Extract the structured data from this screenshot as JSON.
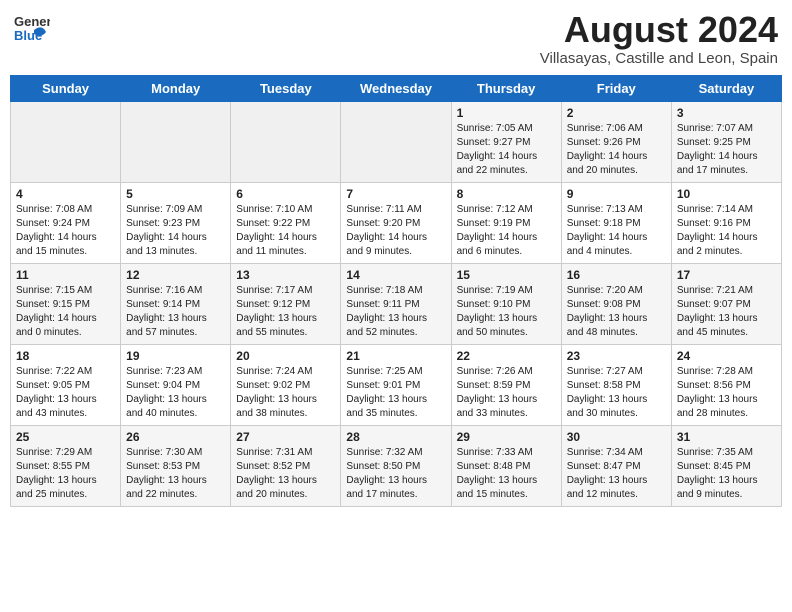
{
  "header": {
    "logo_general": "General",
    "logo_blue": "Blue",
    "month_year": "August 2024",
    "location": "Villasayas, Castille and Leon, Spain"
  },
  "weekdays": [
    "Sunday",
    "Monday",
    "Tuesday",
    "Wednesday",
    "Thursday",
    "Friday",
    "Saturday"
  ],
  "weeks": [
    [
      {
        "day": "",
        "info": ""
      },
      {
        "day": "",
        "info": ""
      },
      {
        "day": "",
        "info": ""
      },
      {
        "day": "",
        "info": ""
      },
      {
        "day": "1",
        "info": "Sunrise: 7:05 AM\nSunset: 9:27 PM\nDaylight: 14 hours\nand 22 minutes."
      },
      {
        "day": "2",
        "info": "Sunrise: 7:06 AM\nSunset: 9:26 PM\nDaylight: 14 hours\nand 20 minutes."
      },
      {
        "day": "3",
        "info": "Sunrise: 7:07 AM\nSunset: 9:25 PM\nDaylight: 14 hours\nand 17 minutes."
      }
    ],
    [
      {
        "day": "4",
        "info": "Sunrise: 7:08 AM\nSunset: 9:24 PM\nDaylight: 14 hours\nand 15 minutes."
      },
      {
        "day": "5",
        "info": "Sunrise: 7:09 AM\nSunset: 9:23 PM\nDaylight: 14 hours\nand 13 minutes."
      },
      {
        "day": "6",
        "info": "Sunrise: 7:10 AM\nSunset: 9:22 PM\nDaylight: 14 hours\nand 11 minutes."
      },
      {
        "day": "7",
        "info": "Sunrise: 7:11 AM\nSunset: 9:20 PM\nDaylight: 14 hours\nand 9 minutes."
      },
      {
        "day": "8",
        "info": "Sunrise: 7:12 AM\nSunset: 9:19 PM\nDaylight: 14 hours\nand 6 minutes."
      },
      {
        "day": "9",
        "info": "Sunrise: 7:13 AM\nSunset: 9:18 PM\nDaylight: 14 hours\nand 4 minutes."
      },
      {
        "day": "10",
        "info": "Sunrise: 7:14 AM\nSunset: 9:16 PM\nDaylight: 14 hours\nand 2 minutes."
      }
    ],
    [
      {
        "day": "11",
        "info": "Sunrise: 7:15 AM\nSunset: 9:15 PM\nDaylight: 14 hours\nand 0 minutes."
      },
      {
        "day": "12",
        "info": "Sunrise: 7:16 AM\nSunset: 9:14 PM\nDaylight: 13 hours\nand 57 minutes."
      },
      {
        "day": "13",
        "info": "Sunrise: 7:17 AM\nSunset: 9:12 PM\nDaylight: 13 hours\nand 55 minutes."
      },
      {
        "day": "14",
        "info": "Sunrise: 7:18 AM\nSunset: 9:11 PM\nDaylight: 13 hours\nand 52 minutes."
      },
      {
        "day": "15",
        "info": "Sunrise: 7:19 AM\nSunset: 9:10 PM\nDaylight: 13 hours\nand 50 minutes."
      },
      {
        "day": "16",
        "info": "Sunrise: 7:20 AM\nSunset: 9:08 PM\nDaylight: 13 hours\nand 48 minutes."
      },
      {
        "day": "17",
        "info": "Sunrise: 7:21 AM\nSunset: 9:07 PM\nDaylight: 13 hours\nand 45 minutes."
      }
    ],
    [
      {
        "day": "18",
        "info": "Sunrise: 7:22 AM\nSunset: 9:05 PM\nDaylight: 13 hours\nand 43 minutes."
      },
      {
        "day": "19",
        "info": "Sunrise: 7:23 AM\nSunset: 9:04 PM\nDaylight: 13 hours\nand 40 minutes."
      },
      {
        "day": "20",
        "info": "Sunrise: 7:24 AM\nSunset: 9:02 PM\nDaylight: 13 hours\nand 38 minutes."
      },
      {
        "day": "21",
        "info": "Sunrise: 7:25 AM\nSunset: 9:01 PM\nDaylight: 13 hours\nand 35 minutes."
      },
      {
        "day": "22",
        "info": "Sunrise: 7:26 AM\nSunset: 8:59 PM\nDaylight: 13 hours\nand 33 minutes."
      },
      {
        "day": "23",
        "info": "Sunrise: 7:27 AM\nSunset: 8:58 PM\nDaylight: 13 hours\nand 30 minutes."
      },
      {
        "day": "24",
        "info": "Sunrise: 7:28 AM\nSunset: 8:56 PM\nDaylight: 13 hours\nand 28 minutes."
      }
    ],
    [
      {
        "day": "25",
        "info": "Sunrise: 7:29 AM\nSunset: 8:55 PM\nDaylight: 13 hours\nand 25 minutes."
      },
      {
        "day": "26",
        "info": "Sunrise: 7:30 AM\nSunset: 8:53 PM\nDaylight: 13 hours\nand 22 minutes."
      },
      {
        "day": "27",
        "info": "Sunrise: 7:31 AM\nSunset: 8:52 PM\nDaylight: 13 hours\nand 20 minutes."
      },
      {
        "day": "28",
        "info": "Sunrise: 7:32 AM\nSunset: 8:50 PM\nDaylight: 13 hours\nand 17 minutes."
      },
      {
        "day": "29",
        "info": "Sunrise: 7:33 AM\nSunset: 8:48 PM\nDaylight: 13 hours\nand 15 minutes."
      },
      {
        "day": "30",
        "info": "Sunrise: 7:34 AM\nSunset: 8:47 PM\nDaylight: 13 hours\nand 12 minutes."
      },
      {
        "day": "31",
        "info": "Sunrise: 7:35 AM\nSunset: 8:45 PM\nDaylight: 13 hours\nand 9 minutes."
      }
    ]
  ]
}
